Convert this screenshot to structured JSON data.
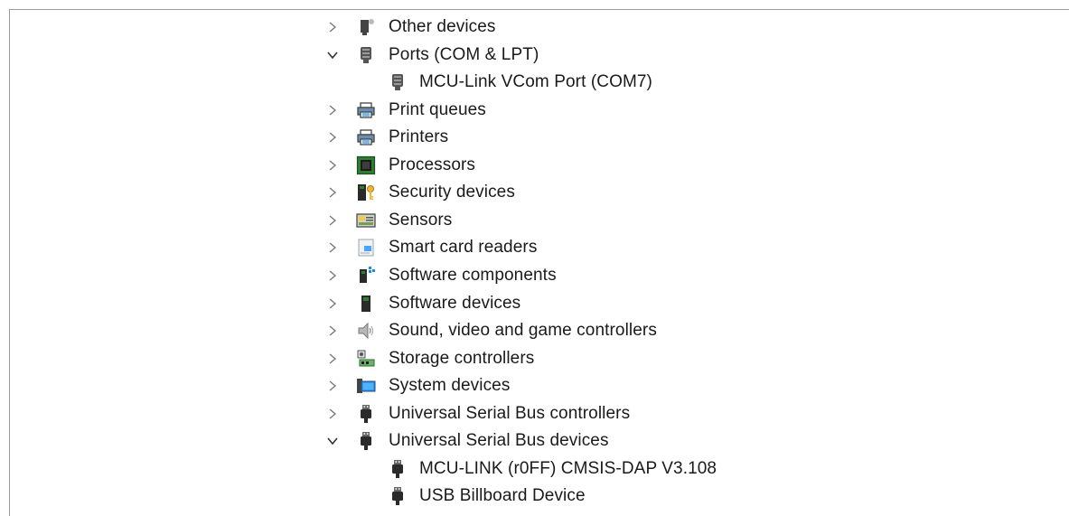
{
  "tree": {
    "items": [
      {
        "label": "Other devices",
        "expander": "collapsed",
        "icon": "other-devices-icon",
        "level": 0
      },
      {
        "label": "Ports (COM & LPT)",
        "expander": "expanded",
        "icon": "port-icon",
        "level": 0
      },
      {
        "label": "MCU-Link VCom Port (COM7)",
        "expander": "none",
        "icon": "port-icon",
        "level": 1
      },
      {
        "label": "Print queues",
        "expander": "collapsed",
        "icon": "printer-icon",
        "level": 0
      },
      {
        "label": "Printers",
        "expander": "collapsed",
        "icon": "printer-icon",
        "level": 0
      },
      {
        "label": "Processors",
        "expander": "collapsed",
        "icon": "processor-icon",
        "level": 0
      },
      {
        "label": "Security devices",
        "expander": "collapsed",
        "icon": "security-key-icon",
        "level": 0
      },
      {
        "label": "Sensors",
        "expander": "collapsed",
        "icon": "sensor-icon",
        "level": 0
      },
      {
        "label": "Smart card readers",
        "expander": "collapsed",
        "icon": "smart-card-icon",
        "level": 0
      },
      {
        "label": "Software components",
        "expander": "collapsed",
        "icon": "software-component-icon",
        "level": 0
      },
      {
        "label": "Software devices",
        "expander": "collapsed",
        "icon": "software-device-icon",
        "level": 0
      },
      {
        "label": "Sound, video and game controllers",
        "expander": "collapsed",
        "icon": "speaker-icon",
        "level": 0
      },
      {
        "label": "Storage controllers",
        "expander": "collapsed",
        "icon": "storage-controller-icon",
        "level": 0
      },
      {
        "label": "System devices",
        "expander": "collapsed",
        "icon": "system-monitor-icon",
        "level": 0
      },
      {
        "label": "Universal Serial Bus controllers",
        "expander": "collapsed",
        "icon": "usb-plug-icon",
        "level": 0
      },
      {
        "label": "Universal Serial Bus devices",
        "expander": "expanded",
        "icon": "usb-plug-icon",
        "level": 0
      },
      {
        "label": "MCU-LINK (r0FF) CMSIS-DAP V3.108",
        "expander": "none",
        "icon": "usb-plug-icon",
        "level": 1
      },
      {
        "label": "USB Billboard Device",
        "expander": "none",
        "icon": "usb-plug-icon",
        "level": 1
      }
    ]
  },
  "colors": {
    "frame_border": "#9a9a9a",
    "text": "#1a1a1a",
    "chevron": "#6e6e6e",
    "accent_blue": "#1e88e5",
    "processor_green": "#2e7d32"
  }
}
